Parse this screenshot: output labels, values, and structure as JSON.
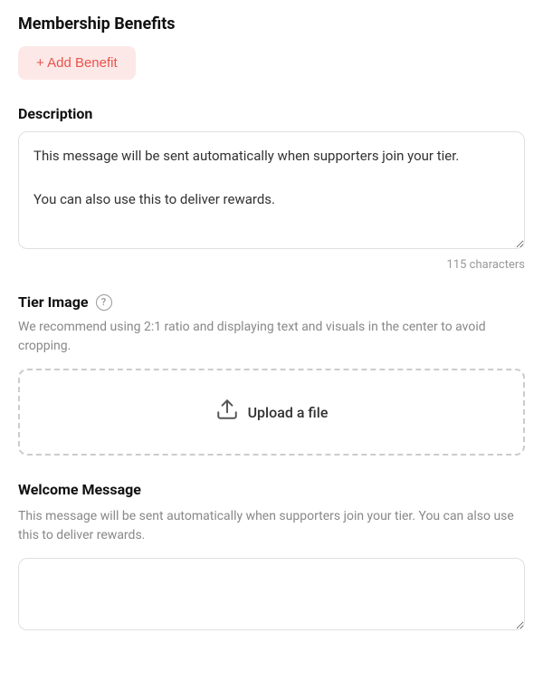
{
  "page": {
    "membership_benefits": {
      "title": "Membership Benefits",
      "add_benefit_label": "+ Add Benefit"
    },
    "description": {
      "label": "Description",
      "value": "This message will be sent automatically when supporters join your tier.\n\nYou can also use this to deliver rewards.",
      "char_count": "115 characters"
    },
    "tier_image": {
      "label": "Tier Image",
      "hint": "We recommend using 2:1 ratio and displaying text and visuals in the center to avoid cropping.",
      "upload_label": "Upload a file",
      "help_icon": "?"
    },
    "welcome_message": {
      "label": "Welcome Message",
      "hint": "This message will be sent automatically when supporters join your tier. You can also use this to deliver rewards.",
      "value": ""
    }
  }
}
